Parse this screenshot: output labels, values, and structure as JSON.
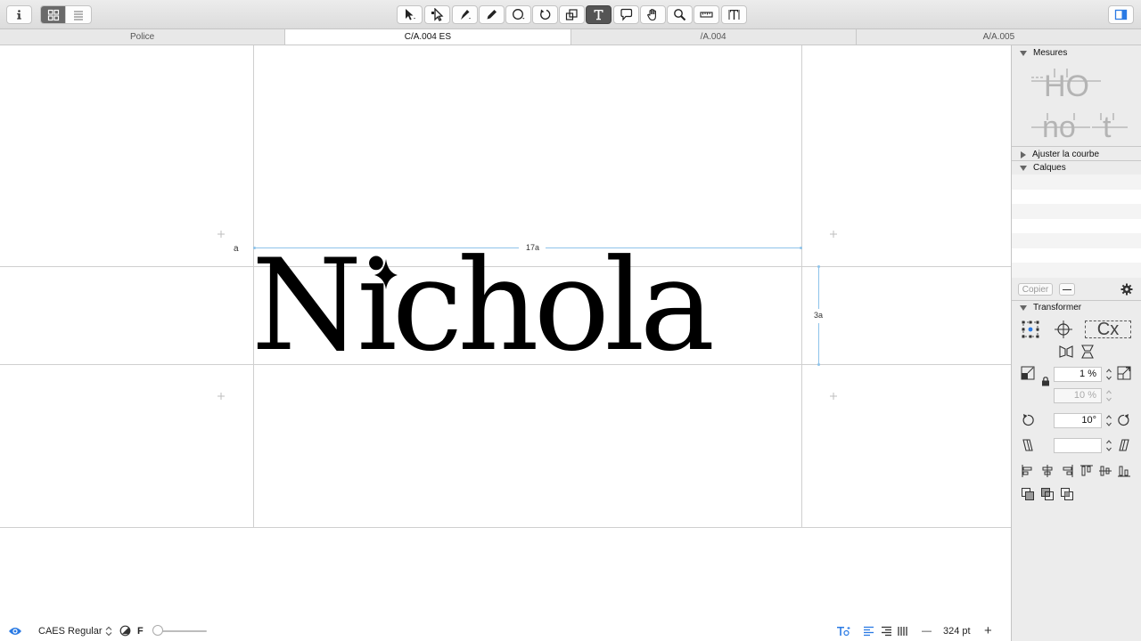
{
  "toolbar": {
    "info_icon": "info-icon",
    "view_modes": [
      "grid-view-icon",
      "list-view-icon"
    ],
    "tools": [
      "select-arrow-icon",
      "node-select-icon",
      "pen-icon",
      "pencil-icon",
      "ellipse-icon",
      "rotate-icon",
      "scale-icon",
      "text-tool-icon",
      "annotation-icon",
      "hand-icon",
      "zoom-icon",
      "measure-icon",
      "metrics-icon"
    ],
    "active_tool": "text-tool-icon",
    "sidebar_toggle_icon": "sidebar-toggle-icon"
  },
  "tabs": [
    {
      "label": "Police",
      "active": false
    },
    {
      "label": "C/A.004 ES",
      "active": true
    },
    {
      "label": "/A.004",
      "active": false
    },
    {
      "label": "A/A.005",
      "active": false
    }
  ],
  "canvas": {
    "preview_text": "Nichola",
    "left_label": "a",
    "width_label": "17a",
    "height_label": "3a"
  },
  "statusbar": {
    "eye_icon": "eye-icon",
    "font_name": "CAES Regular",
    "contrast_icon": "contrast-icon",
    "f_label": "F",
    "zoom_value": "324 pt",
    "minus": "—",
    "plus": "+"
  },
  "panel": {
    "sections": {
      "mesures": "Mesures",
      "ajuster": "Ajuster la courbe",
      "calques": "Calques",
      "transformer": "Transformer"
    },
    "metrics_preview_1": "HO",
    "metrics_preview_2": "no",
    "metrics_preview_3": "t",
    "copy_button": "Copier",
    "minus_button": "—",
    "cx_label": "Cx",
    "scale_x": "1 %",
    "scale_y": "10 %",
    "rotate": "10°",
    "slant": ""
  },
  "colors": {
    "accent": "#2a7ae4",
    "guide": "#c8c8c8",
    "metric_line": "#8ec3ea"
  }
}
